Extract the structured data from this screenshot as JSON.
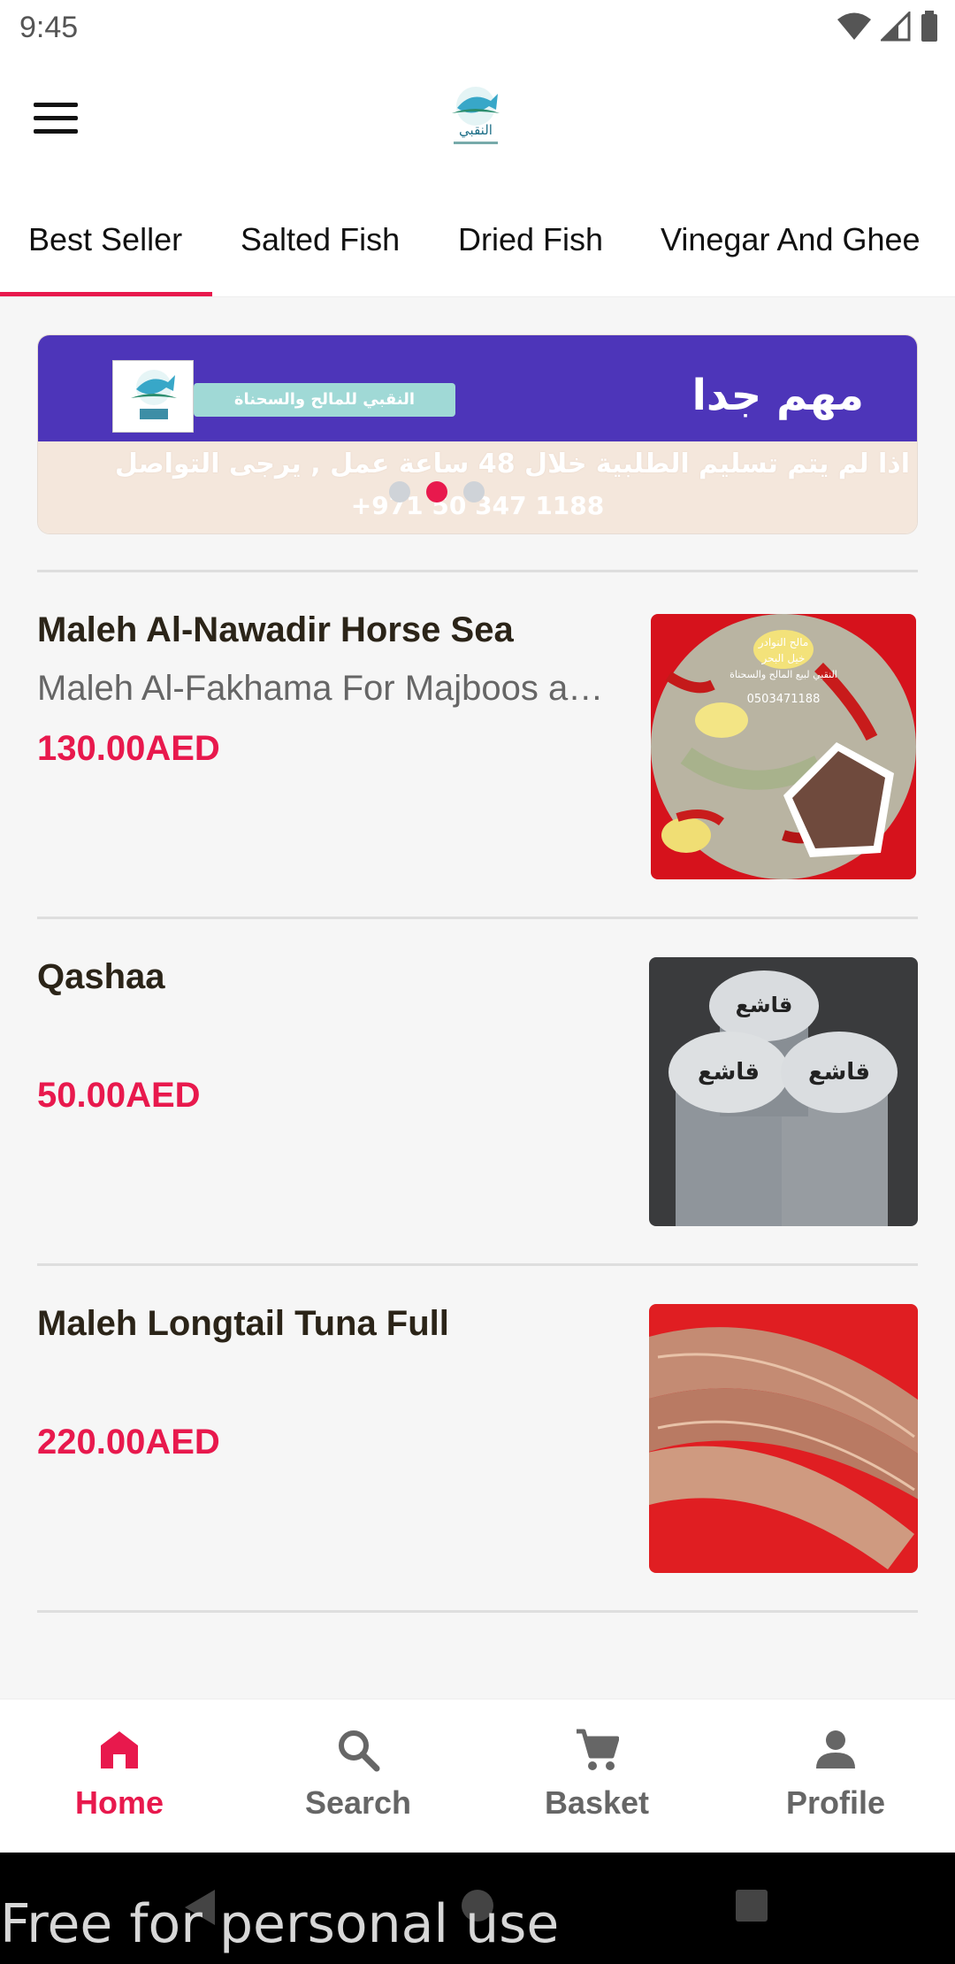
{
  "status_bar": {
    "time": "9:45",
    "icons": [
      "wifi-icon",
      "signal-icon",
      "battery-icon"
    ]
  },
  "app_bar": {
    "menu_icon": "hamburger-menu-icon",
    "logo_text": "النقبي"
  },
  "tabs": [
    {
      "label": "Best Seller",
      "active": true
    },
    {
      "label": "Salted Fish",
      "active": false
    },
    {
      "label": "Dried Fish",
      "active": false
    },
    {
      "label": "Vinegar And Ghee",
      "active": false
    }
  ],
  "banner": {
    "title": "مهم جدا",
    "brand_pill": "النقبي للمالح والسحناة",
    "line1": "اذا لم يتم تسليم الطلبية خلال 48 ساعة عمل , يرجى التواصل",
    "line2": "+971 50 347 1188",
    "dots_count": 3,
    "active_dot": 1
  },
  "products": [
    {
      "name": "Maleh Al-Nawadir Horse Sea",
      "description": "Maleh Al-Fakhama For Majboos and Maleh",
      "price": "130.00AED",
      "image_text": [
        "مالح النوادر",
        "خيل البحر",
        "النقبي لبيع المالح والسحناة",
        "0503471188"
      ]
    },
    {
      "name": "Qashaa",
      "description": "",
      "price": "50.00AED",
      "image_text": [
        "قاشع",
        "قاشع",
        "قاشع"
      ]
    },
    {
      "name": "Maleh Longtail Tuna Full",
      "description": "",
      "price": "220.00AED",
      "image_text": []
    }
  ],
  "bottom_nav": [
    {
      "label": "Home",
      "icon": "home-icon",
      "active": true
    },
    {
      "label": "Search",
      "icon": "search-icon",
      "active": false
    },
    {
      "label": "Basket",
      "icon": "cart-icon",
      "active": false
    },
    {
      "label": "Profile",
      "icon": "profile-icon",
      "active": false
    }
  ],
  "system_nav": [
    "back-icon",
    "home-circle-icon",
    "recents-icon"
  ],
  "watermark": "Free for personal use",
  "colors": {
    "accent": "#e8194d",
    "banner_purple": "#4d35b9",
    "banner_beige": "#f4e7dc",
    "text_dark": "#2b2418"
  }
}
